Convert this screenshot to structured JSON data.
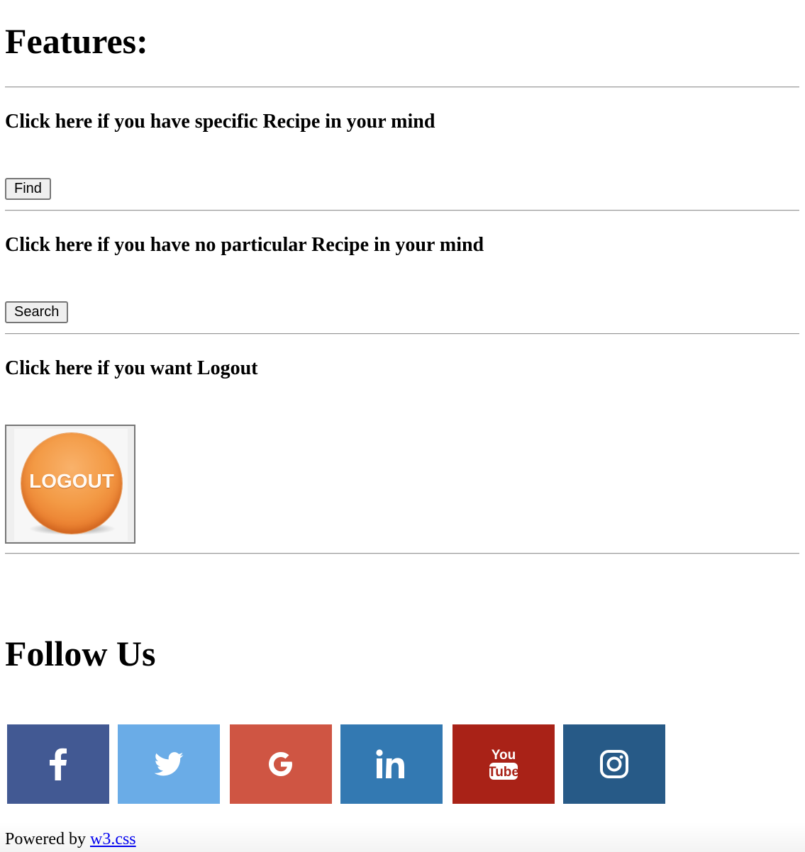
{
  "features": {
    "title": "Features:",
    "items": [
      {
        "prompt": "Click here if you have specific Recipe in your mind",
        "button_label": "Find"
      },
      {
        "prompt": "Click here if you have no particular Recipe in your mind",
        "button_label": "Search"
      },
      {
        "prompt": "Click here if you want Logout",
        "image_text": "LOGOUT"
      }
    ]
  },
  "follow": {
    "title": "Follow Us",
    "links": [
      {
        "name": "facebook",
        "icon": "facebook-icon",
        "color": "#425993"
      },
      {
        "name": "twitter",
        "icon": "twitter-icon",
        "color": "#6aace7"
      },
      {
        "name": "google",
        "icon": "google-icon",
        "color": "#cf5543"
      },
      {
        "name": "linkedin",
        "icon": "linkedin-icon",
        "color": "#3379b2"
      },
      {
        "name": "youtube",
        "icon": "youtube-icon",
        "color": "#a92217",
        "icon_text": [
          "You",
          "Tube"
        ]
      },
      {
        "name": "instagram",
        "icon": "instagram-icon",
        "color": "#275a87"
      }
    ]
  },
  "footer": {
    "prefix": "Powered by",
    "link_text": "w3.css"
  }
}
